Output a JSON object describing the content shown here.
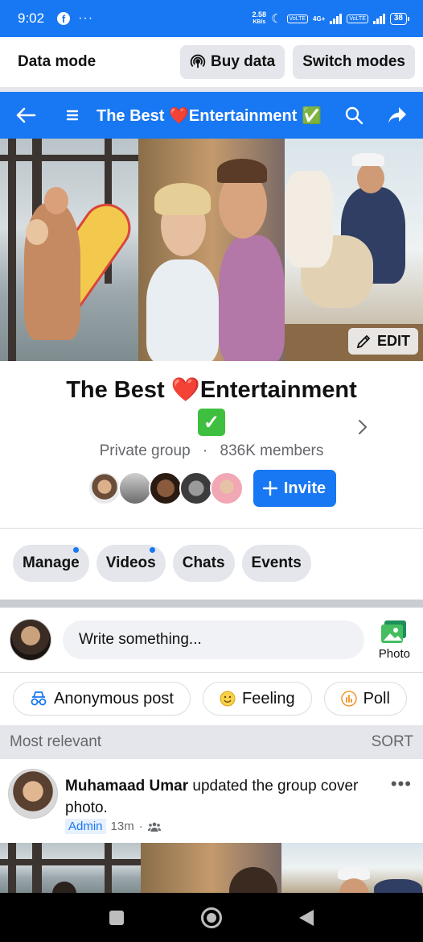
{
  "status_bar": {
    "time": "9:02",
    "more": "···",
    "net_speed_value": "2.58",
    "net_speed_unit": "KB/s",
    "volte1": "VoLTE",
    "net_type": "4G+",
    "volte2": "VoLTE",
    "battery": "38"
  },
  "data_bar": {
    "label": "Data mode",
    "buy_data": "Buy data",
    "switch_modes": "Switch modes"
  },
  "header": {
    "title": "The Best ❤️Entertainment ✅"
  },
  "cover": {
    "edit_label": "EDIT"
  },
  "group": {
    "name": "The Best ❤️Entertainment",
    "check": "✓",
    "privacy": "Private group",
    "separator": "·",
    "members": "836K members",
    "invite_label": "Invite"
  },
  "tabs": [
    {
      "label": "Manage",
      "dot": true
    },
    {
      "label": "Videos",
      "dot": true
    },
    {
      "label": "Chats",
      "dot": false
    },
    {
      "label": "Events",
      "dot": false
    }
  ],
  "composer": {
    "placeholder": "Write something...",
    "photo_label": "Photo"
  },
  "actions": {
    "anonymous": "Anonymous post",
    "feeling": "Feeling",
    "poll": "Poll"
  },
  "feed": {
    "sort_heading": "Most relevant",
    "sort_button": "SORT"
  },
  "post": {
    "author": "Muhamaad Umar",
    "action": " updated the group cover photo.",
    "role": "Admin",
    "time": "13m",
    "dot": "·",
    "more": "•••"
  },
  "colors": {
    "brand": "#1877f2",
    "chip_bg": "#e4e6eb",
    "muted_text": "#65676b",
    "check_green": "#3fbf3f",
    "heart_red": "#e0245e"
  }
}
